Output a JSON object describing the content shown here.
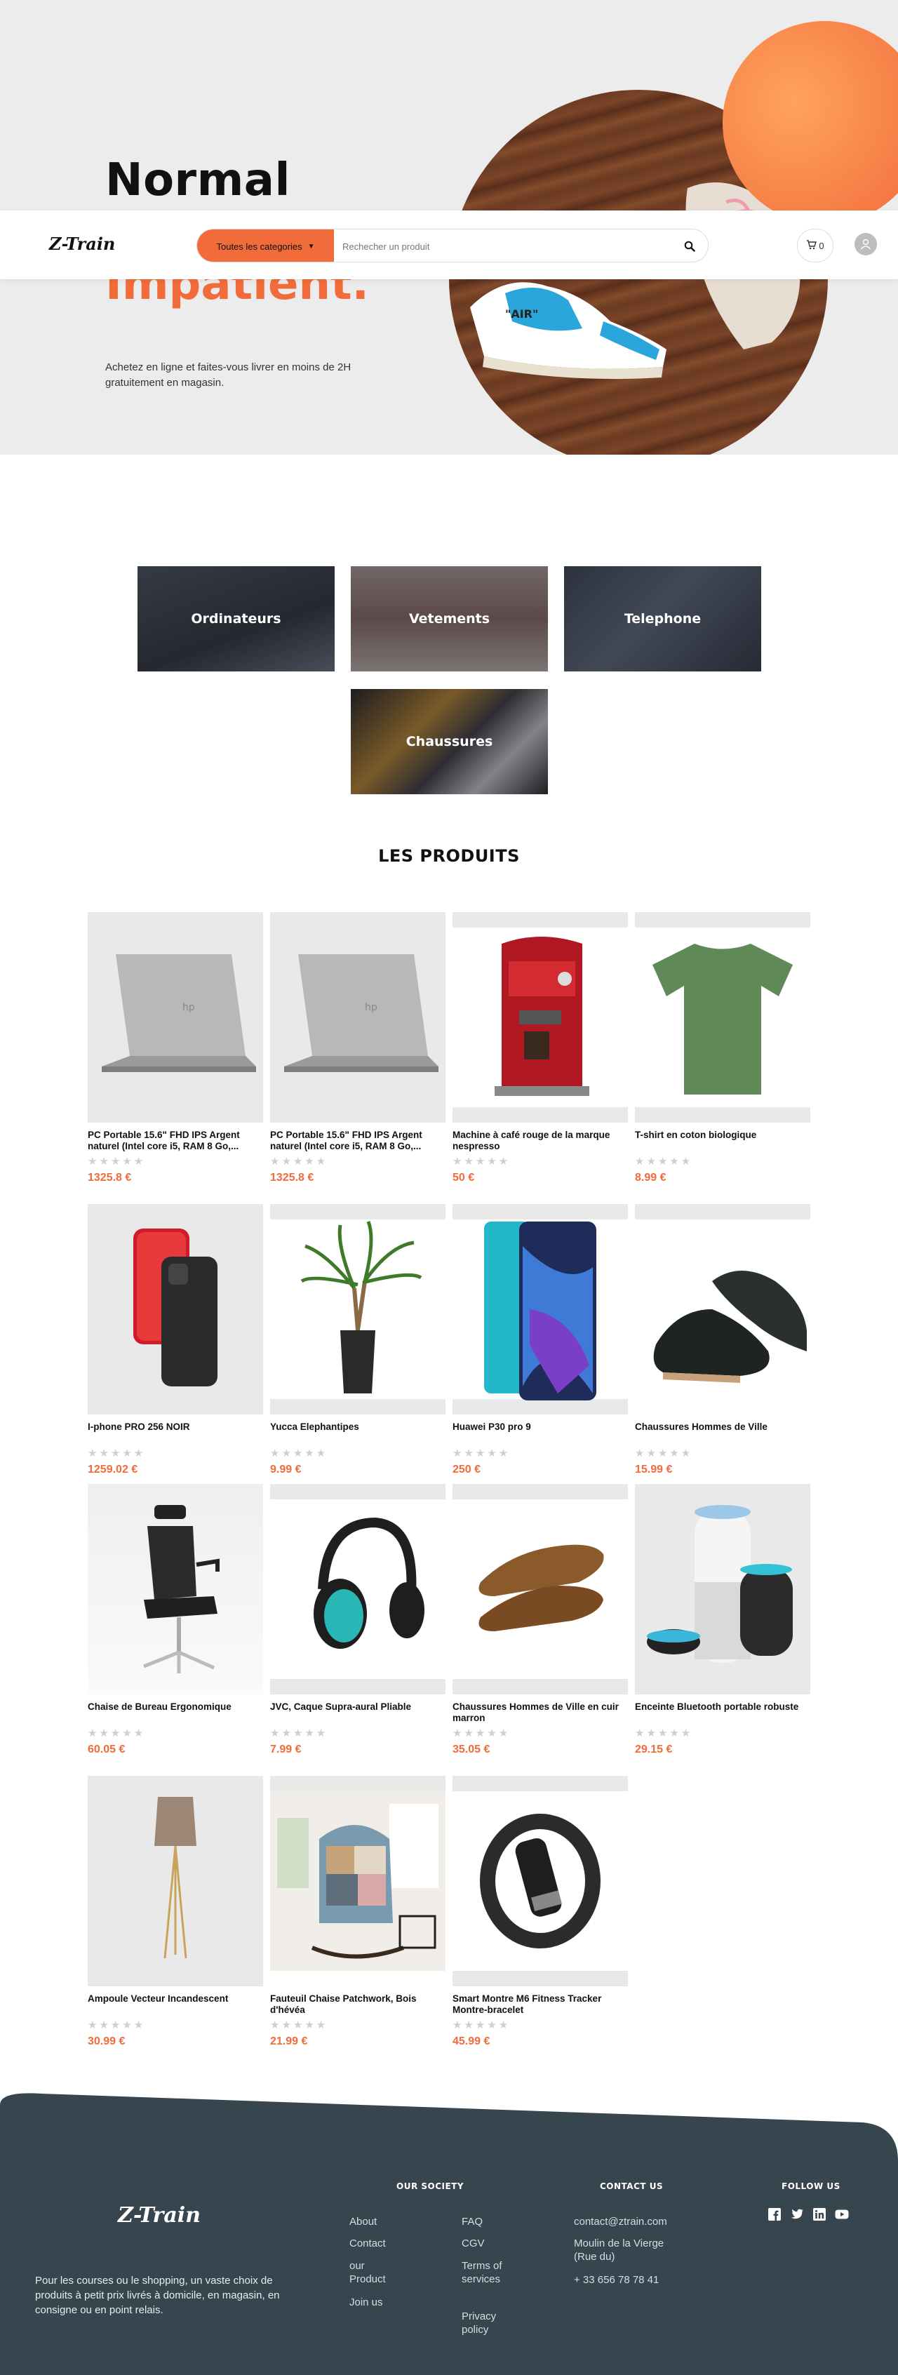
{
  "hero": {
    "title_line1": "Normal",
    "title_line2": "Impatient.",
    "description": "Achetez en ligne et faites-vous livrer en moins de 2H gratuitement en magasin."
  },
  "navbar": {
    "logo": "Z-Train",
    "category_select": "Toutes les categories",
    "search_placeholder": "Rechecher un produit",
    "cart_count": "0",
    "icons": [
      "search-icon",
      "cart-icon",
      "user-icon"
    ]
  },
  "categories": [
    {
      "label": "Ordinateurs"
    },
    {
      "label": "Vetements"
    },
    {
      "label": "Telephone"
    },
    {
      "label": "Chaussures"
    }
  ],
  "products_section": {
    "title": "LES PRODUITS",
    "rating_glyphs": "★★★★★",
    "items": [
      {
        "name": "PC Portable 15.6\" FHD IPS Argent naturel (Intel core i5, RAM 8 Go,...",
        "price": "1325.8 €"
      },
      {
        "name": "PC Portable 15.6\" FHD IPS Argent naturel (Intel core i5, RAM 8 Go,...",
        "price": "1325.8 €"
      },
      {
        "name": "Machine à café rouge de la marque nespresso",
        "price": "50 €"
      },
      {
        "name": "T-shirt en coton biologique",
        "price": "8.99 €"
      },
      {
        "name": "I-phone PRO 256 NOIR",
        "price": "1259.02 €"
      },
      {
        "name": "Yucca Elephantipes",
        "price": "9.99 €"
      },
      {
        "name": "Huawei P30 pro 9",
        "price": "250 €"
      },
      {
        "name": "Chaussures Hommes de Ville",
        "price": "15.99 €"
      },
      {
        "name": "Chaise de Bureau Ergonomique",
        "price": "60.05 €"
      },
      {
        "name": "JVC, Caque Supra-aural Pliable",
        "price": "7.99 €"
      },
      {
        "name": "Chaussures Hommes de Ville en cuir marron",
        "price": "35.05 €"
      },
      {
        "name": "Enceinte Bluetooth portable robuste",
        "price": "29.15 €"
      },
      {
        "name": "Ampoule Vecteur Incandescent",
        "price": "30.99 €"
      },
      {
        "name": "Fauteuil Chaise Patchwork, Bois d'hévéa",
        "price": "21.99 €"
      },
      {
        "name": "Smart Montre M6 Fitness Tracker Montre-bracelet",
        "price": "45.99 €"
      }
    ]
  },
  "footer": {
    "logo": "Z-Train",
    "description": "Pour les courses ou le shopping, un vaste choix de produits à petit prix livrés à domicile, en magasin, en consigne ou en point relais.",
    "society_title": "OUR SOCIETY",
    "society_links_col1": [
      "About",
      "Contact",
      "our Product",
      "Join us"
    ],
    "society_links_col2": [
      "FAQ",
      "CGV",
      "Terms of services",
      "Privacy policy"
    ],
    "contact_title": "CONTACT US",
    "contact_email": "contact@ztrain.com",
    "contact_address": "Moulin de la Vierge (Rue du)",
    "contact_phone": "+ 33 656 78 78 41",
    "follow_title": "FOLLOW US",
    "social_icons": [
      "facebook-icon",
      "twitter-icon",
      "linkedin-icon",
      "youtube-icon"
    ]
  },
  "colors": {
    "accent": "#f26b3a",
    "footer_bg": "#37454f",
    "hero_bg": "#ececec"
  }
}
